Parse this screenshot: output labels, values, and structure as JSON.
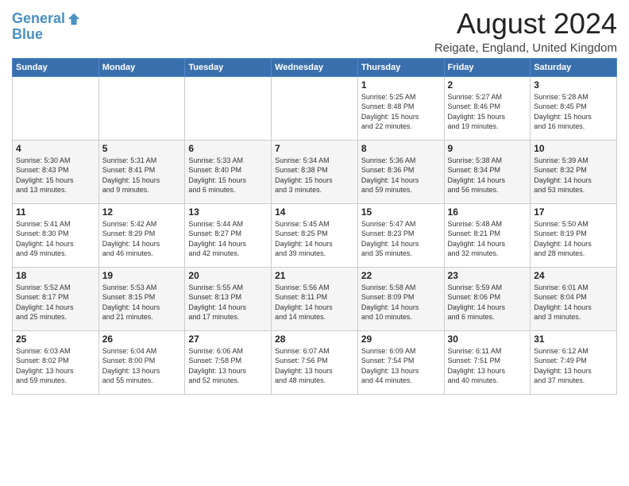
{
  "logo": {
    "line1": "General",
    "line2": "Blue"
  },
  "title": "August 2024",
  "location": "Reigate, England, United Kingdom",
  "days_of_week": [
    "Sunday",
    "Monday",
    "Tuesday",
    "Wednesday",
    "Thursday",
    "Friday",
    "Saturday"
  ],
  "weeks": [
    [
      {
        "day": "",
        "info": ""
      },
      {
        "day": "",
        "info": ""
      },
      {
        "day": "",
        "info": ""
      },
      {
        "day": "",
        "info": ""
      },
      {
        "day": "1",
        "info": "Sunrise: 5:25 AM\nSunset: 8:48 PM\nDaylight: 15 hours\nand 22 minutes."
      },
      {
        "day": "2",
        "info": "Sunrise: 5:27 AM\nSunset: 8:46 PM\nDaylight: 15 hours\nand 19 minutes."
      },
      {
        "day": "3",
        "info": "Sunrise: 5:28 AM\nSunset: 8:45 PM\nDaylight: 15 hours\nand 16 minutes."
      }
    ],
    [
      {
        "day": "4",
        "info": "Sunrise: 5:30 AM\nSunset: 8:43 PM\nDaylight: 15 hours\nand 13 minutes."
      },
      {
        "day": "5",
        "info": "Sunrise: 5:31 AM\nSunset: 8:41 PM\nDaylight: 15 hours\nand 9 minutes."
      },
      {
        "day": "6",
        "info": "Sunrise: 5:33 AM\nSunset: 8:40 PM\nDaylight: 15 hours\nand 6 minutes."
      },
      {
        "day": "7",
        "info": "Sunrise: 5:34 AM\nSunset: 8:38 PM\nDaylight: 15 hours\nand 3 minutes."
      },
      {
        "day": "8",
        "info": "Sunrise: 5:36 AM\nSunset: 8:36 PM\nDaylight: 14 hours\nand 59 minutes."
      },
      {
        "day": "9",
        "info": "Sunrise: 5:38 AM\nSunset: 8:34 PM\nDaylight: 14 hours\nand 56 minutes."
      },
      {
        "day": "10",
        "info": "Sunrise: 5:39 AM\nSunset: 8:32 PM\nDaylight: 14 hours\nand 53 minutes."
      }
    ],
    [
      {
        "day": "11",
        "info": "Sunrise: 5:41 AM\nSunset: 8:30 PM\nDaylight: 14 hours\nand 49 minutes."
      },
      {
        "day": "12",
        "info": "Sunrise: 5:42 AM\nSunset: 8:29 PM\nDaylight: 14 hours\nand 46 minutes."
      },
      {
        "day": "13",
        "info": "Sunrise: 5:44 AM\nSunset: 8:27 PM\nDaylight: 14 hours\nand 42 minutes."
      },
      {
        "day": "14",
        "info": "Sunrise: 5:45 AM\nSunset: 8:25 PM\nDaylight: 14 hours\nand 39 minutes."
      },
      {
        "day": "15",
        "info": "Sunrise: 5:47 AM\nSunset: 8:23 PM\nDaylight: 14 hours\nand 35 minutes."
      },
      {
        "day": "16",
        "info": "Sunrise: 5:48 AM\nSunset: 8:21 PM\nDaylight: 14 hours\nand 32 minutes."
      },
      {
        "day": "17",
        "info": "Sunrise: 5:50 AM\nSunset: 8:19 PM\nDaylight: 14 hours\nand 28 minutes."
      }
    ],
    [
      {
        "day": "18",
        "info": "Sunrise: 5:52 AM\nSunset: 8:17 PM\nDaylight: 14 hours\nand 25 minutes."
      },
      {
        "day": "19",
        "info": "Sunrise: 5:53 AM\nSunset: 8:15 PM\nDaylight: 14 hours\nand 21 minutes."
      },
      {
        "day": "20",
        "info": "Sunrise: 5:55 AM\nSunset: 8:13 PM\nDaylight: 14 hours\nand 17 minutes."
      },
      {
        "day": "21",
        "info": "Sunrise: 5:56 AM\nSunset: 8:11 PM\nDaylight: 14 hours\nand 14 minutes."
      },
      {
        "day": "22",
        "info": "Sunrise: 5:58 AM\nSunset: 8:09 PM\nDaylight: 14 hours\nand 10 minutes."
      },
      {
        "day": "23",
        "info": "Sunrise: 5:59 AM\nSunset: 8:06 PM\nDaylight: 14 hours\nand 6 minutes."
      },
      {
        "day": "24",
        "info": "Sunrise: 6:01 AM\nSunset: 8:04 PM\nDaylight: 14 hours\nand 3 minutes."
      }
    ],
    [
      {
        "day": "25",
        "info": "Sunrise: 6:03 AM\nSunset: 8:02 PM\nDaylight: 13 hours\nand 59 minutes."
      },
      {
        "day": "26",
        "info": "Sunrise: 6:04 AM\nSunset: 8:00 PM\nDaylight: 13 hours\nand 55 minutes."
      },
      {
        "day": "27",
        "info": "Sunrise: 6:06 AM\nSunset: 7:58 PM\nDaylight: 13 hours\nand 52 minutes."
      },
      {
        "day": "28",
        "info": "Sunrise: 6:07 AM\nSunset: 7:56 PM\nDaylight: 13 hours\nand 48 minutes."
      },
      {
        "day": "29",
        "info": "Sunrise: 6:09 AM\nSunset: 7:54 PM\nDaylight: 13 hours\nand 44 minutes."
      },
      {
        "day": "30",
        "info": "Sunrise: 6:11 AM\nSunset: 7:51 PM\nDaylight: 13 hours\nand 40 minutes."
      },
      {
        "day": "31",
        "info": "Sunrise: 6:12 AM\nSunset: 7:49 PM\nDaylight: 13 hours\nand 37 minutes."
      }
    ]
  ]
}
